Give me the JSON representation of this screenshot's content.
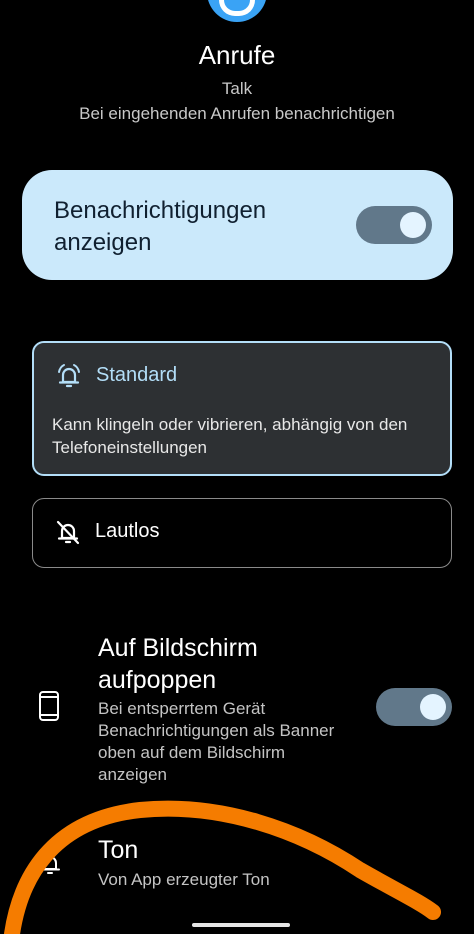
{
  "header": {
    "title": "Anrufe",
    "app_name": "Talk",
    "description": "Bei eingehenden Anrufen benachrichtigen",
    "app_icon": "app-logo-icon",
    "accent_color": "#3aa3f5"
  },
  "show_notifications": {
    "label": "Benachrichtigungen anzeigen",
    "enabled": true
  },
  "options": {
    "standard": {
      "icon": "bell-ringing-icon",
      "title": "Standard",
      "description": "Kann klingeln oder vibrieren, abhängig von den Telefoneinstellungen",
      "selected": true
    },
    "silent": {
      "icon": "bell-off-icon",
      "title": "Lautlos",
      "selected": false
    }
  },
  "popup": {
    "icon": "phone-icon",
    "title": "Auf Bildschirm aufpoppen",
    "description": "Bei entsperrtem Gerät Benachrichtigungen als Banner oben auf dem Bildschirm anzeigen",
    "enabled": true
  },
  "sound": {
    "icon": "bell-icon",
    "title": "Ton",
    "description": "Von App erzeugter Ton"
  },
  "colors": {
    "card_background": "#cbe9fb",
    "selected_border": "#b3def8",
    "toggle_track": "#61788a",
    "annotation_stroke": "#f57c00"
  }
}
